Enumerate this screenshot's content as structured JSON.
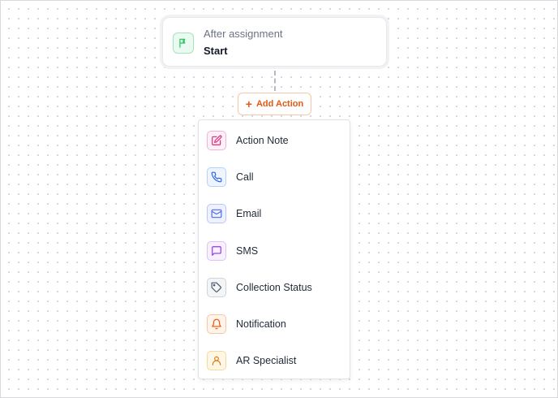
{
  "start": {
    "subtitle": "After assignment",
    "title": "Start",
    "icon": "flag-icon",
    "color": "#22c55e"
  },
  "add_action": {
    "label": "Add Action",
    "icon": "plus-icon",
    "color": "#e8580f"
  },
  "menu": {
    "items": [
      {
        "label": "Action Note",
        "icon": "edit-icon",
        "color": "#db2777",
        "bg": "#fdf0f8",
        "border": "#f3b3d9"
      },
      {
        "label": "Call",
        "icon": "phone-icon",
        "color": "#2563eb",
        "bg": "#eef5ff",
        "border": "#b4d2fb"
      },
      {
        "label": "Email",
        "icon": "mail-icon",
        "color": "#4f6bed",
        "bg": "#eef1ff",
        "border": "#bcc6f6"
      },
      {
        "label": "SMS",
        "icon": "message-icon",
        "color": "#9333ea",
        "bg": "#f7f0ff",
        "border": "#dcc2f7"
      },
      {
        "label": "Collection Status",
        "icon": "tag-icon",
        "color": "#475569",
        "bg": "#f4f5f7",
        "border": "#cfd4db"
      },
      {
        "label": "Notification",
        "icon": "bell-icon",
        "color": "#ea580c",
        "bg": "#fff3ea",
        "border": "#f8c7a3"
      },
      {
        "label": "AR Specialist",
        "icon": "user-icon",
        "color": "#d97706",
        "bg": "#fff7e6",
        "border": "#f6d89a"
      }
    ]
  }
}
